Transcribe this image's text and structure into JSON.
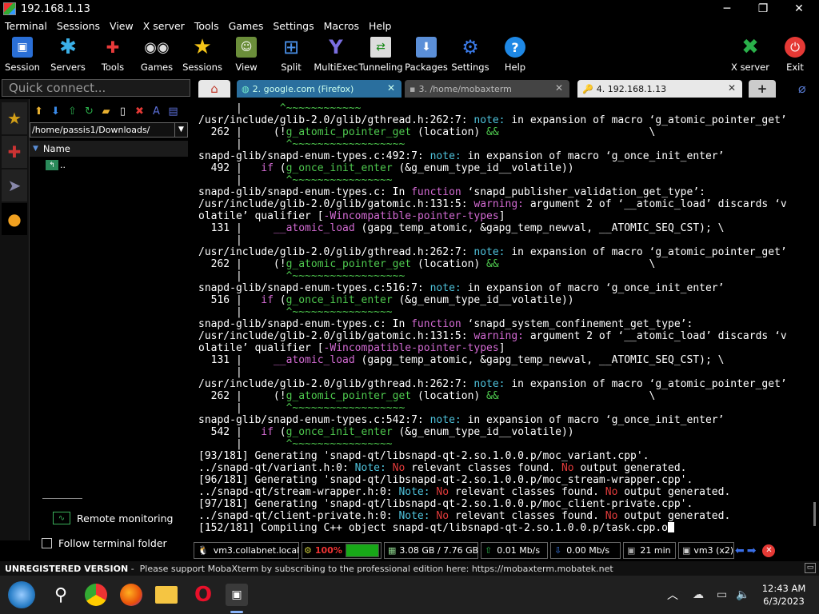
{
  "window": {
    "title": "192.168.1.13",
    "minimize": "─",
    "maximize": "❐",
    "close": "✕"
  },
  "menu": [
    "Terminal",
    "Sessions",
    "View",
    "X server",
    "Tools",
    "Games",
    "Settings",
    "Macros",
    "Help"
  ],
  "toolbar": [
    {
      "label": "Session",
      "icon": "session-icon",
      "glyph": "🖥"
    },
    {
      "label": "Servers",
      "icon": "servers-icon",
      "glyph": "✱"
    },
    {
      "label": "Tools",
      "icon": "tools-icon",
      "glyph": "🔧"
    },
    {
      "label": "Games",
      "icon": "games-icon",
      "glyph": "🎮"
    },
    {
      "label": "Sessions",
      "icon": "star-icon",
      "glyph": "★"
    },
    {
      "label": "View",
      "icon": "view-icon",
      "glyph": "👤"
    },
    {
      "label": "Split",
      "icon": "split-icon",
      "glyph": "⊞"
    },
    {
      "label": "MultiExec",
      "icon": "multiexec-icon",
      "glyph": "Y"
    },
    {
      "label": "Tunneling",
      "icon": "tunneling-icon",
      "glyph": "⇄"
    },
    {
      "label": "Packages",
      "icon": "packages-icon",
      "glyph": "📦"
    },
    {
      "label": "Settings",
      "icon": "settings-icon",
      "glyph": "⚙"
    },
    {
      "label": "Help",
      "icon": "help-icon",
      "glyph": "?"
    }
  ],
  "toolbar_right": [
    {
      "label": "X server",
      "icon": "xserver-icon",
      "glyph": "✖"
    },
    {
      "label": "Exit",
      "icon": "exit-icon",
      "glyph": "⏻"
    }
  ],
  "quick_connect": {
    "placeholder": "Quick connect..."
  },
  "tabs": [
    {
      "label": "2. google.com (Firefox)",
      "close": "✕"
    },
    {
      "label": "3. /home/mobaxterm",
      "close": "✕"
    },
    {
      "label": "4. 192.168.1.13",
      "close": "✕"
    }
  ],
  "tab_add": "+",
  "sftp": {
    "path": "/home/passis1/Downloads/",
    "column": "Name",
    "parent": ".."
  },
  "sidebar_bottom": {
    "remote_monitoring": "Remote monitoring",
    "follow_folder": "Follow terminal folder"
  },
  "terminal_lines": [
    [
      {
        "t": "      |      ",
        "c": "y"
      },
      {
        "t": "^~~~~~~~~~~~~",
        "c": "g"
      }
    ],
    [
      {
        "t": "/usr/include/glib-2.0/glib/gthread.h:262:7: ",
        "c": "y"
      },
      {
        "t": "note: ",
        "c": "c"
      },
      {
        "t": "in expansion of macro ‘g_atomic_pointer_get’",
        "c": "y"
      }
    ],
    [
      {
        "t": "  262 |     (!",
        "c": "y"
      },
      {
        "t": "g_atomic_pointer_get",
        "c": "g"
      },
      {
        "t": " (location) ",
        "c": "y"
      },
      {
        "t": "&&",
        "c": "g"
      },
      {
        "t": "                        \\",
        "c": "y"
      }
    ],
    [
      {
        "t": "      |       ",
        "c": "y"
      },
      {
        "t": "^~~~~~~~~~~~~~~~~~~",
        "c": "g"
      }
    ],
    [
      {
        "t": "snapd-glib/snapd-enum-types.c:492:7: ",
        "c": "y"
      },
      {
        "t": "note: ",
        "c": "c"
      },
      {
        "t": "in expansion of macro ‘g_once_init_enter’",
        "c": "y"
      }
    ],
    [
      {
        "t": "  492 |   ",
        "c": "y"
      },
      {
        "t": "if",
        "c": "m"
      },
      {
        "t": " (",
        "c": "y"
      },
      {
        "t": "g_once_init_enter",
        "c": "g"
      },
      {
        "t": " (&g_enum_type_id__volatile))",
        "c": "y"
      }
    ],
    [
      {
        "t": "      |       ",
        "c": "y"
      },
      {
        "t": "^~~~~~~~~~~~~~~~~",
        "c": "g"
      }
    ],
    [
      {
        "t": "snapd-glib/snapd-enum-types.c: In ",
        "c": "y"
      },
      {
        "t": "function",
        "c": "m"
      },
      {
        "t": " ‘snapd_publisher_validation_get_type’:",
        "c": "y"
      }
    ],
    [
      {
        "t": "/usr/include/glib-2.0/glib/gatomic.h:131:5: ",
        "c": "y"
      },
      {
        "t": "warning: ",
        "c": "m"
      },
      {
        "t": "argument 2 of ‘__atomic_load’ discards ‘v",
        "c": "y"
      }
    ],
    [
      {
        "t": "olatile’ qualifier [",
        "c": "y"
      },
      {
        "t": "-Wincompatible-pointer-types",
        "c": "m"
      },
      {
        "t": "]",
        "c": "y"
      }
    ],
    [
      {
        "t": "  131 |     ",
        "c": "y"
      },
      {
        "t": "__atomic_load",
        "c": "m"
      },
      {
        "t": " (gapg_temp_atomic, &gapg_temp_newval, __ATOMIC_SEQ_CST); \\",
        "c": "y"
      }
    ],
    [
      {
        "t": "      |     ",
        "c": "y"
      }
    ],
    [
      {
        "t": "/usr/include/glib-2.0/glib/gthread.h:262:7: ",
        "c": "y"
      },
      {
        "t": "note: ",
        "c": "c"
      },
      {
        "t": "in expansion of macro ‘g_atomic_pointer_get’",
        "c": "y"
      }
    ],
    [
      {
        "t": "  262 |     (!",
        "c": "y"
      },
      {
        "t": "g_atomic_pointer_get",
        "c": "g"
      },
      {
        "t": " (location) ",
        "c": "y"
      },
      {
        "t": "&&",
        "c": "g"
      },
      {
        "t": "                        \\",
        "c": "y"
      }
    ],
    [
      {
        "t": "      |       ",
        "c": "y"
      },
      {
        "t": "^~~~~~~~~~~~~~~~~~~",
        "c": "g"
      }
    ],
    [
      {
        "t": "snapd-glib/snapd-enum-types.c:516:7: ",
        "c": "y"
      },
      {
        "t": "note: ",
        "c": "c"
      },
      {
        "t": "in expansion of macro ‘g_once_init_enter’",
        "c": "y"
      }
    ],
    [
      {
        "t": "  516 |   ",
        "c": "y"
      },
      {
        "t": "if",
        "c": "m"
      },
      {
        "t": " (",
        "c": "y"
      },
      {
        "t": "g_once_init_enter",
        "c": "g"
      },
      {
        "t": " (&g_enum_type_id__volatile))",
        "c": "y"
      }
    ],
    [
      {
        "t": "      |       ",
        "c": "y"
      },
      {
        "t": "^~~~~~~~~~~~~~~~~",
        "c": "g"
      }
    ],
    [
      {
        "t": "snapd-glib/snapd-enum-types.c: In ",
        "c": "y"
      },
      {
        "t": "function",
        "c": "m"
      },
      {
        "t": " ‘snapd_system_confinement_get_type’:",
        "c": "y"
      }
    ],
    [
      {
        "t": "/usr/include/glib-2.0/glib/gatomic.h:131:5: ",
        "c": "y"
      },
      {
        "t": "warning: ",
        "c": "m"
      },
      {
        "t": "argument 2 of ‘__atomic_load’ discards ‘v",
        "c": "y"
      }
    ],
    [
      {
        "t": "olatile’ qualifier [",
        "c": "y"
      },
      {
        "t": "-Wincompatible-pointer-types",
        "c": "m"
      },
      {
        "t": "]",
        "c": "y"
      }
    ],
    [
      {
        "t": "  131 |     ",
        "c": "y"
      },
      {
        "t": "__atomic_load",
        "c": "m"
      },
      {
        "t": " (gapg_temp_atomic, &gapg_temp_newval, __ATOMIC_SEQ_CST); \\",
        "c": "y"
      }
    ],
    [
      {
        "t": "      |     ",
        "c": "y"
      }
    ],
    [
      {
        "t": "/usr/include/glib-2.0/glib/gthread.h:262:7: ",
        "c": "y"
      },
      {
        "t": "note: ",
        "c": "c"
      },
      {
        "t": "in expansion of macro ‘g_atomic_pointer_get’",
        "c": "y"
      }
    ],
    [
      {
        "t": "  262 |     (!",
        "c": "y"
      },
      {
        "t": "g_atomic_pointer_get",
        "c": "g"
      },
      {
        "t": " (location) ",
        "c": "y"
      },
      {
        "t": "&&",
        "c": "g"
      },
      {
        "t": "                        \\",
        "c": "y"
      }
    ],
    [
      {
        "t": "      |       ",
        "c": "y"
      },
      {
        "t": "^~~~~~~~~~~~~~~~~~~",
        "c": "g"
      }
    ],
    [
      {
        "t": "snapd-glib/snapd-enum-types.c:542:7: ",
        "c": "y"
      },
      {
        "t": "note: ",
        "c": "c"
      },
      {
        "t": "in expansion of macro ‘g_once_init_enter’",
        "c": "y"
      }
    ],
    [
      {
        "t": "  542 |   ",
        "c": "y"
      },
      {
        "t": "if",
        "c": "m"
      },
      {
        "t": " (",
        "c": "y"
      },
      {
        "t": "g_once_init_enter",
        "c": "g"
      },
      {
        "t": " (&g_enum_type_id__volatile))",
        "c": "y"
      }
    ],
    [
      {
        "t": "      |       ",
        "c": "y"
      },
      {
        "t": "^~~~~~~~~~~~~~~~~",
        "c": "g"
      }
    ],
    [
      {
        "t": "[93/181] Generating 'snapd-qt/libsnapd-qt-2.so.1.0.0.p/moc_variant.cpp'.",
        "c": "y"
      }
    ],
    [
      {
        "t": "../snapd-qt/variant.h:0: ",
        "c": "y"
      },
      {
        "t": "Note: ",
        "c": "c"
      },
      {
        "t": "No",
        "c": "r"
      },
      {
        "t": " relevant classes found. ",
        "c": "y"
      },
      {
        "t": "No",
        "c": "r"
      },
      {
        "t": " output generated.",
        "c": "y"
      }
    ],
    [
      {
        "t": "[96/181] Generating 'snapd-qt/libsnapd-qt-2.so.1.0.0.p/moc_stream-wrapper.cpp'.",
        "c": "y"
      }
    ],
    [
      {
        "t": "../snapd-qt/stream-wrapper.h:0: ",
        "c": "y"
      },
      {
        "t": "Note: ",
        "c": "c"
      },
      {
        "t": "No",
        "c": "r"
      },
      {
        "t": " relevant classes found. ",
        "c": "y"
      },
      {
        "t": "No",
        "c": "r"
      },
      {
        "t": " output generated.",
        "c": "y"
      }
    ],
    [
      {
        "t": "[97/181] Generating 'snapd-qt/libsnapd-qt-2.so.1.0.0.p/moc_client-private.cpp'.",
        "c": "y"
      }
    ],
    [
      {
        "t": "../snapd-qt/client-private.h:0: ",
        "c": "y"
      },
      {
        "t": "Note: ",
        "c": "c"
      },
      {
        "t": "No",
        "c": "r"
      },
      {
        "t": " relevant classes found. ",
        "c": "y"
      },
      {
        "t": "No",
        "c": "r"
      },
      {
        "t": " output generated.",
        "c": "y"
      }
    ],
    [
      {
        "t": "[152/181] Compiling C++ object snapd-qt/libsnapd-qt-2.so.1.0.0.p/task.cpp.o",
        "c": "y"
      }
    ]
  ],
  "status": {
    "host": "vm3.collabnet.local",
    "cpu": "100%",
    "cpu_level": 1.0,
    "memory": "3.08 GB / 7.76 GB",
    "upload": "0.01 Mb/s",
    "download": "0.00 Mb/s",
    "uptime": "21 min",
    "user": "vm3 (x2)"
  },
  "unregistered": {
    "label": "UNREGISTERED VERSION",
    "message": " -  Please support MobaXterm by subscribing to the professional edition here: ",
    "link": "https://mobaxterm.mobatek.net"
  },
  "clock": {
    "time": "12:43 AM",
    "date": "6/3/2023"
  },
  "colors": {
    "accent": "#2aa4d8",
    "cpu_bar": "#18a818",
    "terminal_green": "#4ec94e",
    "terminal_magenta": "#d26ad2",
    "terminal_cyan": "#4fc3dc"
  }
}
